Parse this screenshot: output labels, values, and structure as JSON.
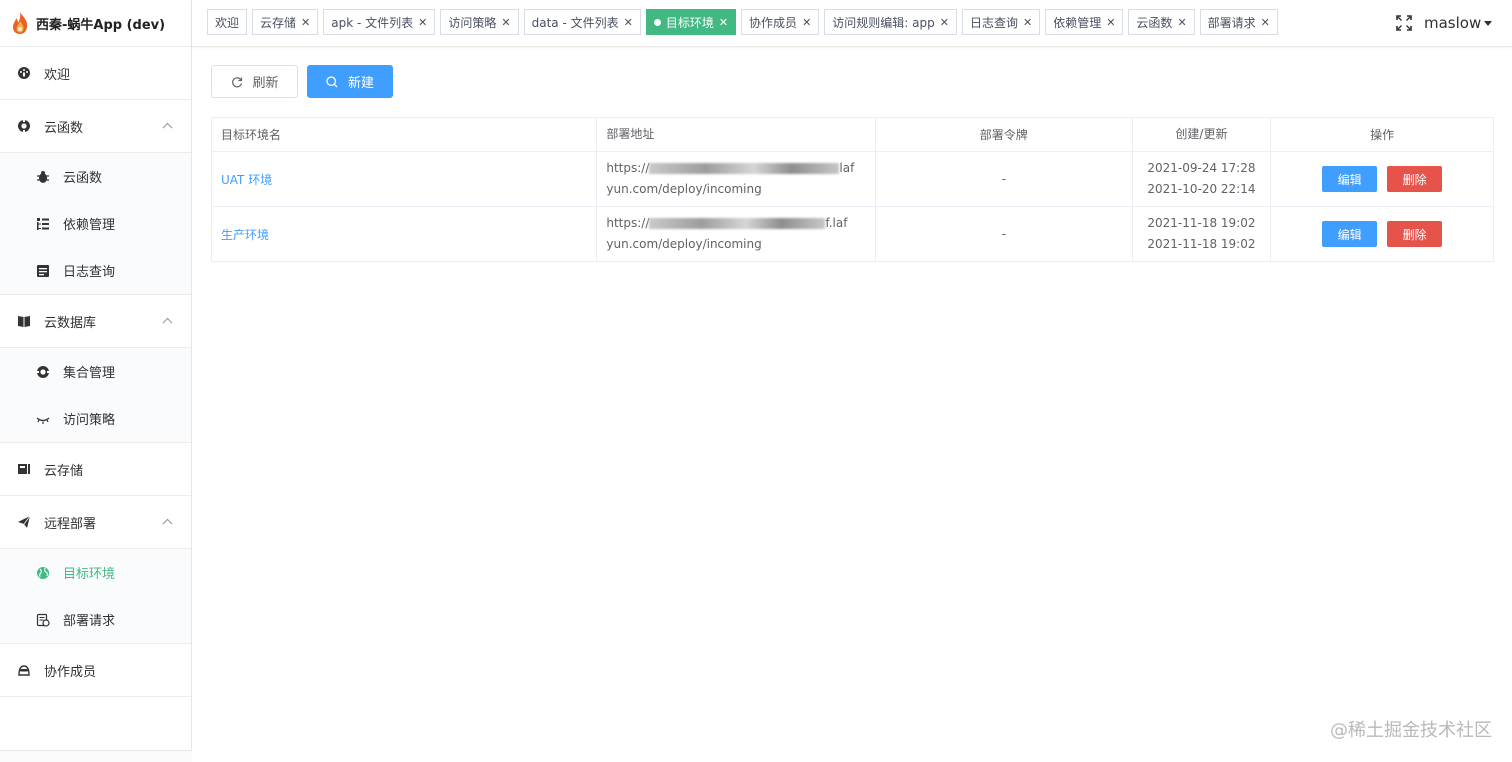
{
  "app": {
    "title": "西秦-蜗牛App (dev)"
  },
  "sidebar": {
    "items": [
      {
        "label": "欢迎",
        "icon": "dashboard-icon"
      },
      {
        "label": "云函数",
        "icon": "function-icon",
        "children": [
          {
            "label": "云函数",
            "icon": "bug-icon"
          },
          {
            "label": "依赖管理",
            "icon": "tree-list-icon"
          },
          {
            "label": "日志查询",
            "icon": "log-document-icon"
          }
        ]
      },
      {
        "label": "云数据库",
        "icon": "database-book-icon",
        "children": [
          {
            "label": "集合管理",
            "icon": "collection-icon"
          },
          {
            "label": "访问策略",
            "icon": "eye-closed-icon"
          }
        ]
      },
      {
        "label": "云存储",
        "icon": "storage-icon"
      },
      {
        "label": "远程部署",
        "icon": "paper-plane-icon",
        "children": [
          {
            "label": "目标环境",
            "icon": "globe-icon",
            "active": true
          },
          {
            "label": "部署请求",
            "icon": "deploy-request-icon"
          }
        ]
      },
      {
        "label": "协作成员",
        "icon": "members-icon"
      }
    ]
  },
  "tabs": [
    {
      "label": "欢迎",
      "closable": false
    },
    {
      "label": "云存储",
      "closable": true
    },
    {
      "label": "apk - 文件列表",
      "closable": true
    },
    {
      "label": "访问策略",
      "closable": true
    },
    {
      "label": "data - 文件列表",
      "closable": true
    },
    {
      "label": "目标环境",
      "closable": true,
      "active": true
    },
    {
      "label": "协作成员",
      "closable": true
    },
    {
      "label": "访问规则编辑: app",
      "closable": true
    },
    {
      "label": "日志查询",
      "closable": true
    },
    {
      "label": "依赖管理",
      "closable": true
    },
    {
      "label": "云函数",
      "closable": true
    },
    {
      "label": "部署请求",
      "closable": true
    }
  ],
  "header": {
    "username": "maslow"
  },
  "toolbar": {
    "refresh_label": "刷新",
    "new_label": "新建"
  },
  "table": {
    "columns": [
      "目标环境名",
      "部署地址",
      "部署令牌",
      "创建/更新",
      "操作"
    ],
    "rows": [
      {
        "name": "UAT 环境",
        "url_line1_start": "https://",
        "url_line1_end": "laf",
        "url_line2": "yun.com/deploy/incoming",
        "token": "-",
        "created": "2021-09-24 17:28",
        "updated": "2021-10-20 22:14"
      },
      {
        "name": "生产环境",
        "url_line1_start": "https://",
        "url_line1_end": "f.laf",
        "url_line2": "yun.com/deploy/incoming",
        "token": "-",
        "created": "2021-11-18 19:02",
        "updated": "2021-11-18 19:02"
      }
    ],
    "edit_label": "编辑",
    "delete_label": "删除"
  },
  "watermark": "@稀土掘金技术社区",
  "colors": {
    "accent": "#42b983",
    "primary": "#409eff",
    "danger": "#e5534b"
  }
}
